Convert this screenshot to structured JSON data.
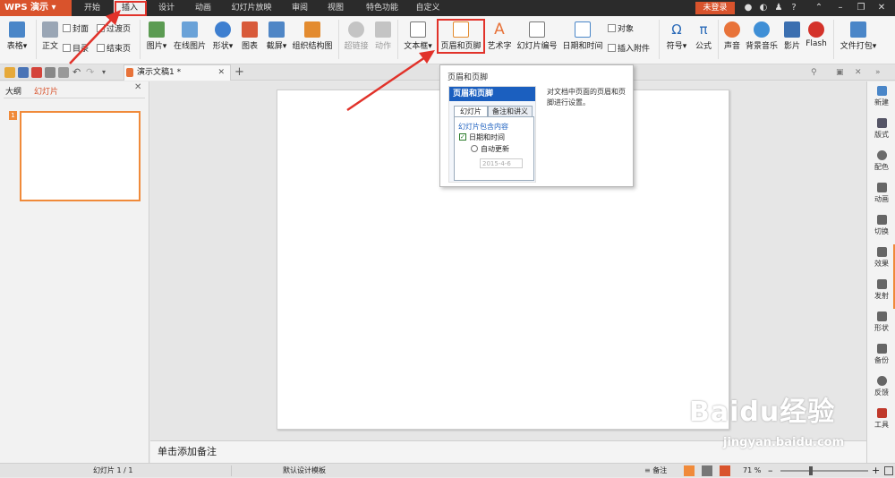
{
  "app": {
    "name": "WPS 演示",
    "login": "未登录"
  },
  "tabs": [
    "开始",
    "插入",
    "设计",
    "动画",
    "幻灯片放映",
    "审阅",
    "视图",
    "特色功能",
    "自定义"
  ],
  "ribbon": {
    "table": "表格",
    "body": "正文",
    "cover": "封面",
    "transition_page": "过渡页",
    "toc": "目录",
    "end_page": "结束页",
    "picture": "图片",
    "online_picture": "在线图片",
    "shape": "形状",
    "chart": "图表",
    "screenshot": "截屏",
    "org_chart": "组织结构图",
    "hyperlink": "超链接",
    "action": "动作",
    "textbox": "文本框",
    "header_footer": "页眉和页脚",
    "wordart": "艺术字",
    "slide_number": "幻灯片编号",
    "date_time": "日期和时间",
    "object": "对象",
    "insert_attachment": "插入附件",
    "symbol": "符号",
    "formula": "公式",
    "sound": "声音",
    "bg_music": "背景音乐",
    "movie": "影片",
    "flash": "Flash",
    "pack": "文件打包"
  },
  "doc_tab": {
    "title": "演示文稿1 *"
  },
  "left_pane": {
    "outline_tab": "大纲",
    "slides_tab": "幻灯片",
    "thumb_number": "1"
  },
  "notes_placeholder": "单击添加备注",
  "right_panel": [
    "新建",
    "版式",
    "配色",
    "动画",
    "切换",
    "效果",
    "发射",
    "形状",
    "备份",
    "反馈",
    "工具"
  ],
  "status": {
    "slide_count": "幻灯片 1 / 1",
    "template": "默认设计模板",
    "notes": "备注",
    "zoom": "71 %"
  },
  "tooltip": {
    "title": "页眉和页脚",
    "preview_header": "页眉和页脚",
    "preview_tab1": "幻灯片",
    "preview_tab2": "备注和讲义",
    "preview_section": "幻灯片包含内容",
    "preview_check": "日期和时间",
    "preview_radio": "自动更新",
    "preview_date": "2015-4-6",
    "description": "对文档中页面的页眉和页脚进行设置。"
  },
  "watermark": {
    "brand": "Baidu经验",
    "url": "jingyan.baidu.com"
  },
  "colors": {
    "accent": "#d9532c",
    "highlight": "#e1322a",
    "titlebar": "#2b2b2b"
  }
}
